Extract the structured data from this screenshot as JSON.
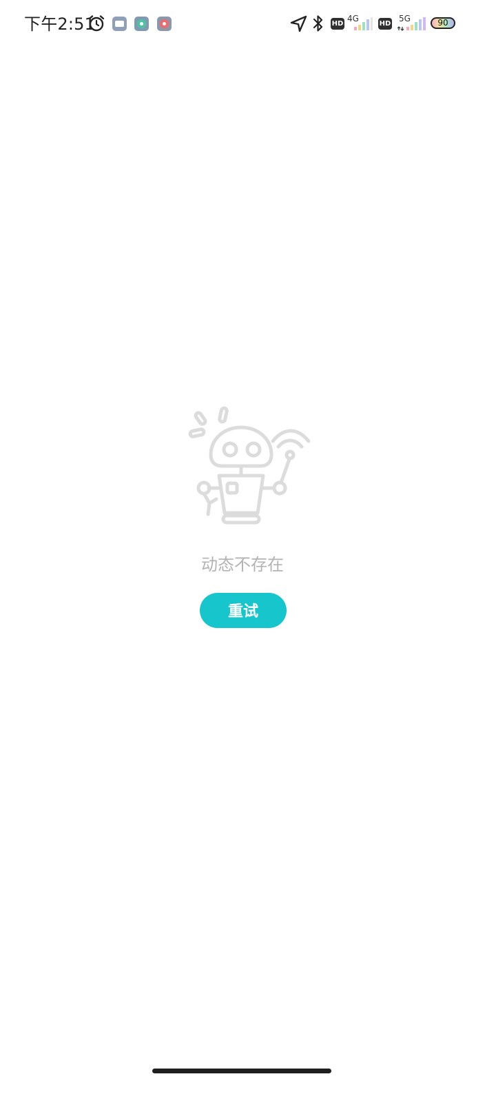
{
  "status_bar": {
    "time": "下午2:51",
    "icons": [
      "alarm-icon",
      "message-app-icon",
      "compass-app-icon",
      "red-app-icon",
      "location-icon",
      "bluetooth-icon"
    ],
    "sim1": {
      "hd": "HD",
      "network": "4G"
    },
    "sim2": {
      "hd": "HD",
      "network": "5G"
    },
    "battery": "90"
  },
  "empty_state": {
    "illustration": "robot-icon",
    "message": "动态不存在",
    "retry_label": "重试"
  },
  "colors": {
    "accent": "#17c6cc",
    "message_text": "#b3b3b3",
    "illustration_stroke": "#dcdcdc"
  }
}
